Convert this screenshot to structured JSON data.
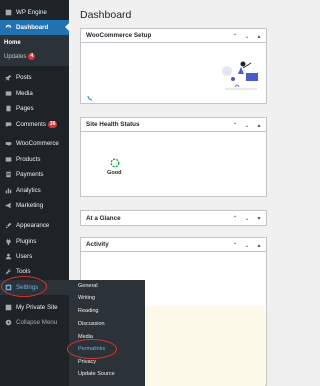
{
  "sidebar": {
    "wp_engine": "WP Engine",
    "dashboard": "Dashboard",
    "submenu": {
      "home": "Home",
      "updates": "Updates",
      "updates_count": "4"
    },
    "items": {
      "posts": "Posts",
      "media": "Media",
      "pages": "Pages",
      "comments": "Comments",
      "comments_count": "36",
      "woocommerce": "WooCommerce",
      "products": "Products",
      "payments": "Payments",
      "analytics": "Analytics",
      "marketing": "Marketing",
      "appearance": "Appearance",
      "plugins": "Plugins",
      "users": "Users",
      "tools": "Tools",
      "settings": "Settings",
      "my_private_site": "My Private Site",
      "collapse_menu": "Collapse Menu"
    }
  },
  "settings_flyout": {
    "items": [
      "General",
      "Writing",
      "Reading",
      "Discussion",
      "Media",
      "Permalinks",
      "Privacy",
      "Update Source"
    ]
  },
  "main": {
    "title": "Dashboard",
    "cards": {
      "woocommerce_setup": "WooCommerce Setup",
      "site_health": "Site Health Status",
      "site_health_status": "Good",
      "at_a_glance": "At a Glance",
      "activity": "Activity"
    }
  },
  "colors": {
    "sidebar_bg": "#1d2327",
    "active_blue": "#2271b1",
    "highlight_red": "#d63638",
    "good_green": "#00a32a"
  }
}
